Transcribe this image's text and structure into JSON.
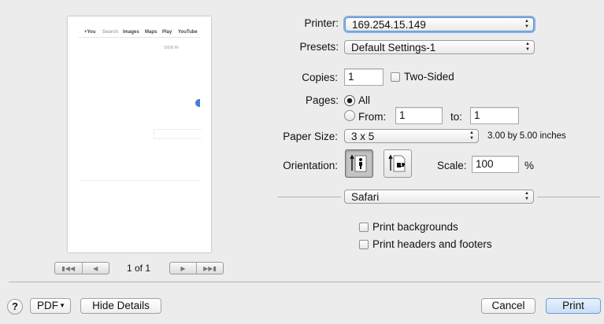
{
  "preview": {
    "page_nav": [
      "+You",
      "Search",
      "Images",
      "Maps",
      "Play",
      "YouTube"
    ],
    "sign_in": "SIGN IN",
    "page_count": "1 of 1",
    "nav_icons": [
      "first-page-icon",
      "previous-page-icon",
      "next-page-icon",
      "last-page-icon"
    ]
  },
  "form": {
    "printer_label": "Printer:",
    "printer_value": "169.254.15.149",
    "presets_label": "Presets:",
    "presets_value": "Default Settings-1",
    "copies_label": "Copies:",
    "copies_value": "1",
    "two_sided_label": "Two-Sided",
    "two_sided_checked": false,
    "pages_label": "Pages:",
    "pages_all_label": "All",
    "pages_from_label": "From:",
    "pages_from_value": "1",
    "pages_to_label": "to:",
    "pages_to_value": "1",
    "pages_selected": "All",
    "paper_size_label": "Paper Size:",
    "paper_size_value": "3 x 5",
    "paper_size_desc": "3.00 by 5.00 inches",
    "orientation_label": "Orientation:",
    "orientation_selected": "portrait",
    "scale_label": "Scale:",
    "scale_value": "100",
    "scale_unit": "%",
    "section_value": "Safari",
    "print_backgrounds_label": "Print backgrounds",
    "print_backgrounds_checked": false,
    "print_headers_label": "Print headers and footers",
    "print_headers_checked": false
  },
  "footer": {
    "help_label": "?",
    "pdf_label": "PDF",
    "hide_details_label": "Hide Details",
    "cancel_label": "Cancel",
    "print_label": "Print"
  },
  "colors": {
    "background": "#ececec",
    "focus_ring": "#7fb1e8",
    "primary_button": "#c9def7"
  }
}
